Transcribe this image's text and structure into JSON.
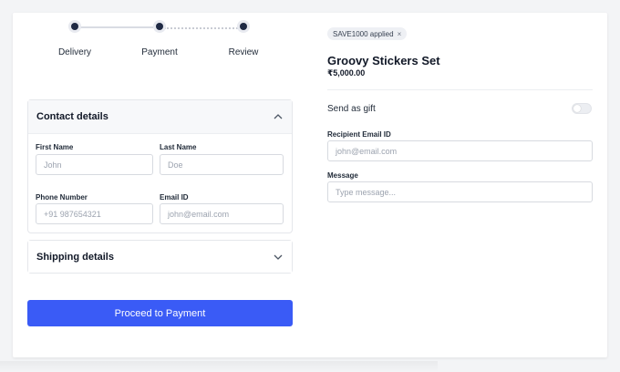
{
  "stepper": {
    "steps": [
      {
        "label": "Delivery"
      },
      {
        "label": "Payment"
      },
      {
        "label": "Review"
      }
    ]
  },
  "contact": {
    "title": "Contact details",
    "first_name": {
      "label": "First Name",
      "placeholder": "John"
    },
    "last_name": {
      "label": "Last Name",
      "placeholder": "Doe"
    },
    "phone": {
      "label": "Phone Number",
      "placeholder": "+91 987654321"
    },
    "email": {
      "label": "Email ID",
      "placeholder": "john@email.com"
    }
  },
  "shipping": {
    "title": "Shipping details"
  },
  "actions": {
    "proceed_label": "Proceed to Payment"
  },
  "coupon": {
    "text": "SAVE1000 applied",
    "remove_glyph": "×"
  },
  "product": {
    "name": "Groovy Stickers Set",
    "price": "₹5,000.00"
  },
  "gift": {
    "label": "Send as gift",
    "enabled": false,
    "recipient_email": {
      "label": "Recipient Email ID",
      "placeholder": "john@email.com"
    },
    "message": {
      "label": "Message",
      "placeholder": "Type message..."
    }
  },
  "icons": {
    "chevron_up": "chevron-up-icon",
    "chevron_down": "chevron-down-icon",
    "close": "close-icon"
  },
  "colors": {
    "primary": "#3a5bf6",
    "step_dot": "#1f2a44"
  }
}
